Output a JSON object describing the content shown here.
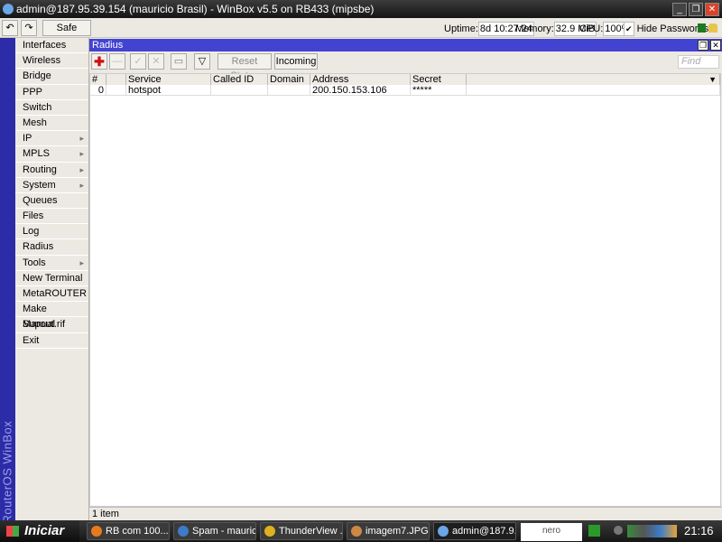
{
  "window": {
    "title": "admin@187.95.39.154 (mauricio Brasil) - WinBox v5.5 on RB433 (mipsbe)"
  },
  "toolbar": {
    "undo": "↶",
    "redo": "↷",
    "safe_mode": "Safe Mode",
    "uptime_label": "Uptime:",
    "uptime": "8d 10:27:24",
    "memory_label": "Memory:",
    "memory": "32.9 MiB",
    "cpu_label": "CPU:",
    "cpu": "100%",
    "hide_passwords": "Hide Passwords",
    "hide_passwords_checked": true
  },
  "sidebar": {
    "brand": "RouterOS WinBox",
    "items": [
      {
        "label": "Interfaces"
      },
      {
        "label": "Wireless"
      },
      {
        "label": "Bridge"
      },
      {
        "label": "PPP"
      },
      {
        "label": "Switch"
      },
      {
        "label": "Mesh"
      },
      {
        "label": "IP",
        "submenu": true
      },
      {
        "label": "MPLS",
        "submenu": true
      },
      {
        "label": "Routing",
        "submenu": true
      },
      {
        "label": "System",
        "submenu": true
      },
      {
        "label": "Queues"
      },
      {
        "label": "Files"
      },
      {
        "label": "Log"
      },
      {
        "label": "Radius"
      },
      {
        "label": "Tools",
        "submenu": true
      },
      {
        "label": "New Terminal"
      },
      {
        "label": "MetaROUTER"
      },
      {
        "label": "Make Supout.rif"
      },
      {
        "label": "Manual"
      },
      {
        "label": "Exit"
      }
    ]
  },
  "radius": {
    "title": "Radius",
    "reset_status": "Reset Status",
    "incoming": "Incoming",
    "find_placeholder": "Find",
    "columns": [
      "#",
      "",
      "Service",
      "Called ID",
      "Domain",
      "Address",
      "Secret"
    ],
    "rows": [
      {
        "num": "0",
        "flag": "",
        "service": "hotspot",
        "called_id": "",
        "domain": "",
        "address": "200.150.153.106",
        "secret": "*****"
      }
    ],
    "status": "1 item"
  },
  "taskbar": {
    "start": "Iniciar",
    "tasks": [
      "RB com 100...",
      "Spam - mauric...",
      "ThunderView ...",
      "imagem7.JPG ...",
      "admin@187.9..."
    ],
    "clock": "21:16",
    "nero": "nero"
  },
  "colors": {
    "accent": "#4343d2",
    "strip": "#2c2ca8"
  }
}
